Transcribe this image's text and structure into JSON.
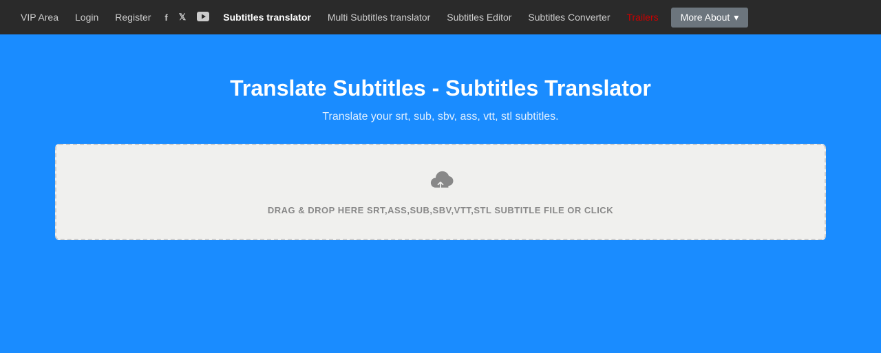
{
  "nav": {
    "links": [
      {
        "id": "vip-area",
        "label": "VIP Area",
        "active": false,
        "special": false
      },
      {
        "id": "login",
        "label": "Login",
        "active": false,
        "special": false
      },
      {
        "id": "register",
        "label": "Register",
        "active": false,
        "special": false
      },
      {
        "id": "subtitles-translator",
        "label": "Subtitles translator",
        "active": true,
        "special": false
      },
      {
        "id": "multi-subtitles-translator",
        "label": "Multi Subtitles translator",
        "active": false,
        "special": false
      },
      {
        "id": "subtitles-editor",
        "label": "Subtitles Editor",
        "active": false,
        "special": false
      },
      {
        "id": "subtitles-converter",
        "label": "Subtitles Converter",
        "active": false,
        "special": false
      },
      {
        "id": "trailers",
        "label": "Trailers",
        "active": false,
        "special": "red"
      }
    ],
    "more_about_label": "More About",
    "social": {
      "facebook": "f",
      "twitter": "t",
      "youtube": "▶"
    }
  },
  "hero": {
    "title": "Translate Subtitles - Subtitles Translator",
    "subtitle": "Translate your srt, sub, sbv, ass, vtt, stl subtitles."
  },
  "dropzone": {
    "text": "DRAG & DROP HERE SRT,ASS,SUB,SBV,VTT,STL SUBTITLE FILE OR CLICK"
  }
}
